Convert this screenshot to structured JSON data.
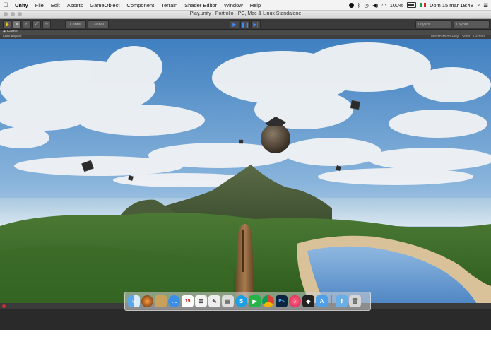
{
  "menubar": {
    "app_name": "Unity",
    "items": [
      "File",
      "Edit",
      "Assets",
      "GameObject",
      "Component",
      "Terrain",
      "Shader Editor",
      "Window",
      "Help"
    ],
    "battery": "100%",
    "datetime": "Dom 15 mar  18:48"
  },
  "window": {
    "title": "Play.unity - Portfolio - PC, Mac & Linux Standalone"
  },
  "toolbar": {
    "center_label": "Center",
    "global_label": "Global",
    "layers_label": "Layers",
    "layout_label": "Layout"
  },
  "tab": {
    "game_label": "Game"
  },
  "controls": {
    "aspect_label": "Free Aspect",
    "maximize_label": "Maximize on Play",
    "stats_label": "Stats",
    "gizmos_label": "Gizmos"
  },
  "colors": {
    "play_accent": "#3c8dff",
    "sky_top": "#3f7fc0",
    "grass": "#3d6a2c"
  },
  "dock": {
    "icons": [
      "finder-icon",
      "launchpad-icon",
      "notes-icon",
      "messages-icon",
      "calendar-icon",
      "reminders-icon",
      "textedit-icon",
      "preview-icon",
      "skype-icon",
      "facetime-icon",
      "chrome-icon",
      "photoshop-icon",
      "itunes-icon",
      "unity-icon",
      "appstore-icon",
      "downloads-icon",
      "trash-icon"
    ]
  }
}
